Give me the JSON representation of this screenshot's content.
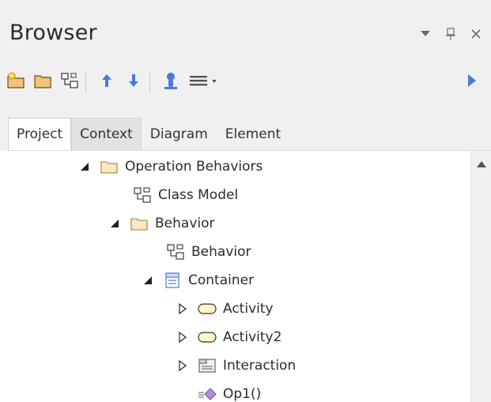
{
  "panel": {
    "title": "Browser"
  },
  "title_controls": {
    "dropdown_icon": "triangle-down",
    "pin_icon": "pin",
    "close_icon": "close"
  },
  "toolbar": {
    "buttons": [
      {
        "icon": "new-package"
      },
      {
        "icon": "folder"
      },
      {
        "icon": "new-diagram"
      },
      {
        "icon": "move-up"
      },
      {
        "icon": "move-down"
      },
      {
        "icon": "locate"
      },
      {
        "icon": "menu-dropdown"
      }
    ],
    "run_icon": "run"
  },
  "tabs": [
    {
      "label": "Project",
      "active": true
    },
    {
      "label": "Context",
      "active": false
    },
    {
      "label": "Diagram",
      "active": false
    },
    {
      "label": "Element",
      "active": false
    }
  ],
  "tree": [
    {
      "label": "Operation Behaviors",
      "expander": "expanded",
      "icon": "folder",
      "level": 0
    },
    {
      "label": "Class Model",
      "expander": "none",
      "icon": "diagram",
      "level": 1
    },
    {
      "label": "Behavior",
      "expander": "expanded",
      "icon": "folder",
      "level": 1
    },
    {
      "label": "Behavior",
      "expander": "none",
      "icon": "diagram",
      "level": 2
    },
    {
      "label": "Container",
      "expander": "expanded",
      "icon": "class",
      "level": 2
    },
    {
      "label": "Activity",
      "expander": "collapsed",
      "icon": "activity",
      "level": 3
    },
    {
      "label": "Activity2",
      "expander": "collapsed",
      "icon": "activity",
      "level": 3
    },
    {
      "label": "Interaction",
      "expander": "collapsed",
      "icon": "interaction",
      "level": 3
    },
    {
      "label": "Op1()",
      "expander": "none",
      "icon": "operation",
      "level": 3
    }
  ],
  "colors": {
    "accent_blue": "#4a7bd8",
    "folder_fill": "#f4d9a0",
    "package_fill": "#f2c27a"
  }
}
